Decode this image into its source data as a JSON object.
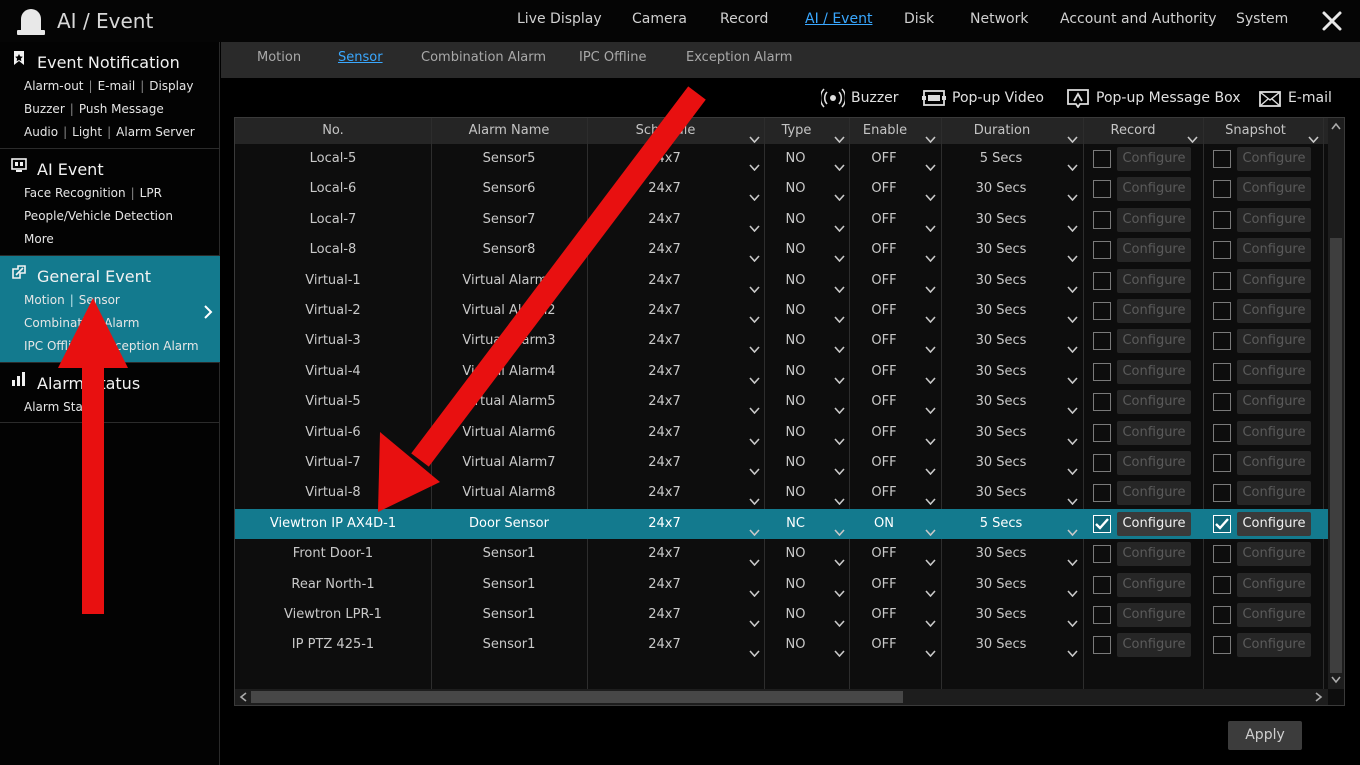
{
  "app": {
    "title": "AI / Event"
  },
  "topnav": [
    "Live Display",
    "Camera",
    "Record",
    "AI / Event",
    "Disk",
    "Network",
    "Account and Authority",
    "System"
  ],
  "topnav_active": "AI / Event",
  "sidebar": {
    "groups": [
      {
        "title": "Event Notification",
        "icon": "bookmark-icon",
        "lines": [
          [
            "Alarm-out",
            "E-mail",
            "Display"
          ],
          [
            "Buzzer",
            "Push Message"
          ],
          [
            "Audio",
            "Light",
            "Alarm Server"
          ]
        ]
      },
      {
        "title": "AI Event",
        "icon": "ai-event-icon",
        "lines": [
          [
            "Face Recognition",
            "LPR"
          ],
          [
            "People/Vehicle Detection"
          ],
          [
            "More"
          ]
        ]
      },
      {
        "title": "General Event",
        "icon": "general-event-icon",
        "active": true,
        "lines": [
          [
            "Motion",
            "Sensor"
          ],
          [
            "Combination Alarm"
          ],
          [
            "IPC Offline",
            "Exception Alarm"
          ]
        ]
      },
      {
        "title": "Alarm Status",
        "icon": "bar-chart-icon",
        "lines": [
          [
            "Alarm Status"
          ]
        ]
      }
    ]
  },
  "subnav": [
    "Motion",
    "Sensor",
    "Combination Alarm",
    "IPC Offline",
    "Exception Alarm"
  ],
  "subnav_active": "Sensor",
  "actions": [
    {
      "label": "Buzzer",
      "icon": "buzzer-icon"
    },
    {
      "label": "Pop-up Video",
      "icon": "popup-video-icon"
    },
    {
      "label": "Pop-up Message Box",
      "icon": "popup-message-icon"
    },
    {
      "label": "E-mail",
      "icon": "email-icon"
    }
  ],
  "table": {
    "headers": [
      "No.",
      "Alarm Name",
      "Schedule",
      "Type",
      "Enable",
      "Duration",
      "Record",
      "Snapshot"
    ],
    "configure_label": "Configure",
    "rows": [
      {
        "no": "Local-5",
        "name": "Sensor5",
        "schedule": "24x7",
        "type": "NO",
        "enable": "OFF",
        "duration": "5 Secs",
        "record": false,
        "snapshot": false
      },
      {
        "no": "Local-6",
        "name": "Sensor6",
        "schedule": "24x7",
        "type": "NO",
        "enable": "OFF",
        "duration": "30 Secs",
        "record": false,
        "snapshot": false
      },
      {
        "no": "Local-7",
        "name": "Sensor7",
        "schedule": "24x7",
        "type": "NO",
        "enable": "OFF",
        "duration": "30 Secs",
        "record": false,
        "snapshot": false
      },
      {
        "no": "Local-8",
        "name": "Sensor8",
        "schedule": "24x7",
        "type": "NO",
        "enable": "OFF",
        "duration": "30 Secs",
        "record": false,
        "snapshot": false
      },
      {
        "no": "Virtual-1",
        "name": "Virtual Alarm1",
        "schedule": "24x7",
        "type": "NO",
        "enable": "OFF",
        "duration": "30 Secs",
        "record": false,
        "snapshot": false
      },
      {
        "no": "Virtual-2",
        "name": "Virtual Alarm2",
        "schedule": "24x7",
        "type": "NO",
        "enable": "OFF",
        "duration": "30 Secs",
        "record": false,
        "snapshot": false
      },
      {
        "no": "Virtual-3",
        "name": "Virtual Alarm3",
        "schedule": "24x7",
        "type": "NO",
        "enable": "OFF",
        "duration": "30 Secs",
        "record": false,
        "snapshot": false
      },
      {
        "no": "Virtual-4",
        "name": "Virtual Alarm4",
        "schedule": "24x7",
        "type": "NO",
        "enable": "OFF",
        "duration": "30 Secs",
        "record": false,
        "snapshot": false
      },
      {
        "no": "Virtual-5",
        "name": "Virtual Alarm5",
        "schedule": "24x7",
        "type": "NO",
        "enable": "OFF",
        "duration": "30 Secs",
        "record": false,
        "snapshot": false
      },
      {
        "no": "Virtual-6",
        "name": "Virtual Alarm6",
        "schedule": "24x7",
        "type": "NO",
        "enable": "OFF",
        "duration": "30 Secs",
        "record": false,
        "snapshot": false
      },
      {
        "no": "Virtual-7",
        "name": "Virtual Alarm7",
        "schedule": "24x7",
        "type": "NO",
        "enable": "OFF",
        "duration": "30 Secs",
        "record": false,
        "snapshot": false
      },
      {
        "no": "Virtual-8",
        "name": "Virtual Alarm8",
        "schedule": "24x7",
        "type": "NO",
        "enable": "OFF",
        "duration": "30 Secs",
        "record": false,
        "snapshot": false
      },
      {
        "no": "Viewtron IP AX4D-1",
        "name": "Door Sensor",
        "schedule": "24x7",
        "type": "NC",
        "enable": "ON",
        "duration": "5 Secs",
        "record": true,
        "snapshot": true,
        "selected": true
      },
      {
        "no": "Front Door-1",
        "name": "Sensor1",
        "schedule": "24x7",
        "type": "NO",
        "enable": "OFF",
        "duration": "30 Secs",
        "record": false,
        "snapshot": false
      },
      {
        "no": "Rear North-1",
        "name": "Sensor1",
        "schedule": "24x7",
        "type": "NO",
        "enable": "OFF",
        "duration": "30 Secs",
        "record": false,
        "snapshot": false
      },
      {
        "no": "Viewtron LPR-1",
        "name": "Sensor1",
        "schedule": "24x7",
        "type": "NO",
        "enable": "OFF",
        "duration": "30 Secs",
        "record": false,
        "snapshot": false
      },
      {
        "no": "IP PTZ 425-1",
        "name": "Sensor1",
        "schedule": "24x7",
        "type": "NO",
        "enable": "OFF",
        "duration": "30 Secs",
        "record": false,
        "snapshot": false
      }
    ]
  },
  "apply_label": "Apply",
  "colors": {
    "accent": "#137a8e",
    "link": "#3aa8ff",
    "arrow": "#e81010"
  }
}
